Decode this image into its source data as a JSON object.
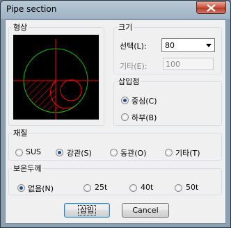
{
  "window": {
    "title": "Pipe section"
  },
  "shape_group": {
    "legend": "형상"
  },
  "size_group": {
    "legend": "크기",
    "select_label": "선택(L):",
    "select_label_key": "L",
    "select_value": "80",
    "other_label": "기타(E):",
    "other_value": "100"
  },
  "insert_point_group": {
    "legend": "삽입점",
    "options": [
      {
        "label": "중심(C)",
        "checked": true
      },
      {
        "label": "하부(B)",
        "checked": false
      }
    ]
  },
  "material_group": {
    "legend": "재질",
    "options": [
      {
        "label": "SUS",
        "checked": false
      },
      {
        "label": "강관(S)",
        "checked": true
      },
      {
        "label": "동관(O)",
        "checked": false
      },
      {
        "label": "기타(T)",
        "checked": false
      }
    ]
  },
  "insulation_group": {
    "legend": "보온두께",
    "options": [
      {
        "label": "없음(N)",
        "checked": true
      },
      {
        "label": "25t",
        "checked": false
      },
      {
        "label": "40t",
        "checked": false
      },
      {
        "label": "50t",
        "checked": false
      }
    ]
  },
  "buttons": {
    "insert": "삽입",
    "cancel": "Cancel"
  },
  "colors": {
    "preview_bg": "#000000",
    "circle": "#00c000",
    "axes": "#ff0000",
    "hatch": "#ff0000"
  },
  "icons": {
    "close": "close-icon"
  }
}
